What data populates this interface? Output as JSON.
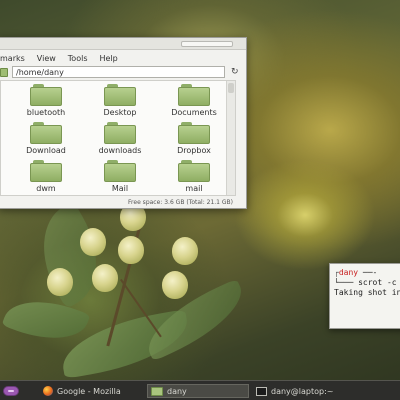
{
  "file_manager": {
    "menu": [
      "marks",
      "View",
      "Tools",
      "Help"
    ],
    "path": "/home/dany",
    "items": [
      {
        "label": "bluetooth",
        "icon": "folder-icon"
      },
      {
        "label": "Desktop",
        "icon": "folder-icon"
      },
      {
        "label": "Documents",
        "icon": "folder-icon"
      },
      {
        "label": "Download",
        "icon": "folder-icon"
      },
      {
        "label": "downloads",
        "icon": "folder-icon"
      },
      {
        "label": "Dropbox",
        "icon": "folder-icon"
      },
      {
        "label": "dwm",
        "icon": "folder-icon"
      },
      {
        "label": "Mail",
        "icon": "folder-icon"
      },
      {
        "label": "mail",
        "icon": "folder-icon"
      }
    ],
    "status": "Free space: 3.6 GB (Total: 21.1 GB)"
  },
  "terminal": {
    "user": "dany",
    "prompt_tail": " ──- ",
    "command": "└─── scrot -c",
    "output": "Taking shot in"
  },
  "taskbar": {
    "tasks": [
      {
        "label": "Google - Mozilla",
        "icon": "firefox-icon"
      },
      {
        "label": "dany",
        "icon": "folder-icon"
      },
      {
        "label": "dany@laptop:~",
        "icon": "terminal-icon"
      }
    ]
  },
  "colors": {
    "folder": "#9fbd73",
    "taskbar": "#2d2d2b",
    "start_button": "#9b58b2",
    "terminal_user": "#c82020"
  }
}
